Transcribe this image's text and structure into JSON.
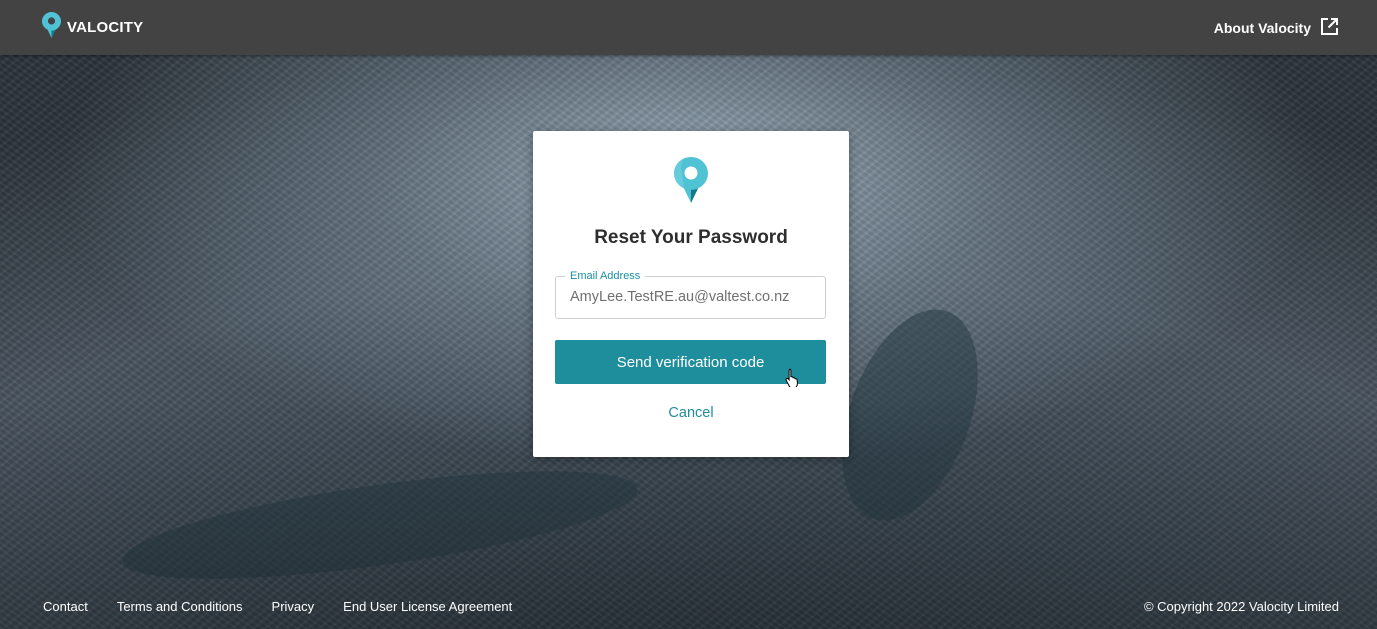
{
  "header": {
    "brand_name": "VALOCITY",
    "about_label": "About Valocity"
  },
  "card": {
    "title": "Reset Your Password",
    "email_label": "Email Address",
    "email_value": "AmyLee.TestRE.au@valtest.co.nz",
    "send_button_label": "Send verification code",
    "cancel_label": "Cancel"
  },
  "footer": {
    "links": [
      "Contact",
      "Terms and Conditions",
      "Privacy",
      "End User License Agreement"
    ],
    "copyright": "© Copyright 2022 Valocity Limited"
  },
  "icons": {
    "logo": "location-pin-icon",
    "external_link": "external-link-icon",
    "cursor": "hand-pointer-icon"
  },
  "colors": {
    "header_bg": "#434343",
    "accent": "#1e8e9c",
    "logo_light": "#4fc3d4",
    "logo_dark": "#137a89"
  }
}
